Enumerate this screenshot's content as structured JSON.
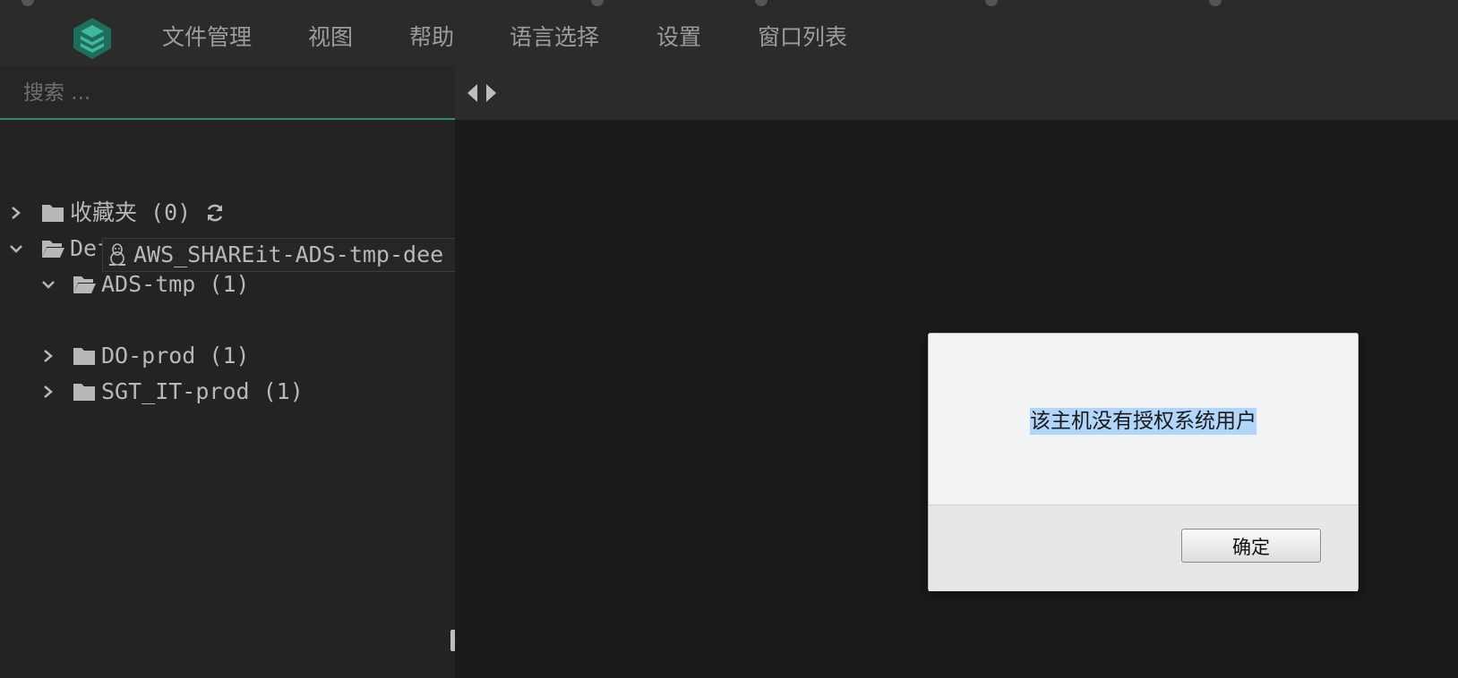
{
  "menubar": {
    "logo_icon": "stacked-layers-logo",
    "items": [
      "文件管理",
      "视图",
      "帮助",
      "语言选择",
      "设置",
      "窗口列表"
    ]
  },
  "sidebar": {
    "search_placeholder": "搜索 ...",
    "tree": [
      {
        "label": "收藏夹 (0)",
        "state": "collapsed",
        "icon": "folder-icon",
        "has_refresh": true
      },
      {
        "label": "Default (3)",
        "state": "expanded",
        "icon": "folder-open-icon"
      },
      {
        "label": "ADS-tmp (1)",
        "state": "expanded",
        "icon": "folder-open-icon"
      },
      {
        "label": "AWS_SHAREit-ADS-tmp-dee",
        "state": "leaf",
        "icon": "linux-tux-icon"
      },
      {
        "label": "DO-prod (1)",
        "state": "collapsed",
        "icon": "folder-icon"
      },
      {
        "label": "SGT_IT-prod (1)",
        "state": "collapsed",
        "icon": "folder-icon"
      }
    ]
  },
  "dialog": {
    "message": "该主机没有授权系统用户",
    "ok_label": "确定"
  },
  "colors": {
    "accent": "#2f8a78",
    "selection": "#b2d5fb"
  }
}
